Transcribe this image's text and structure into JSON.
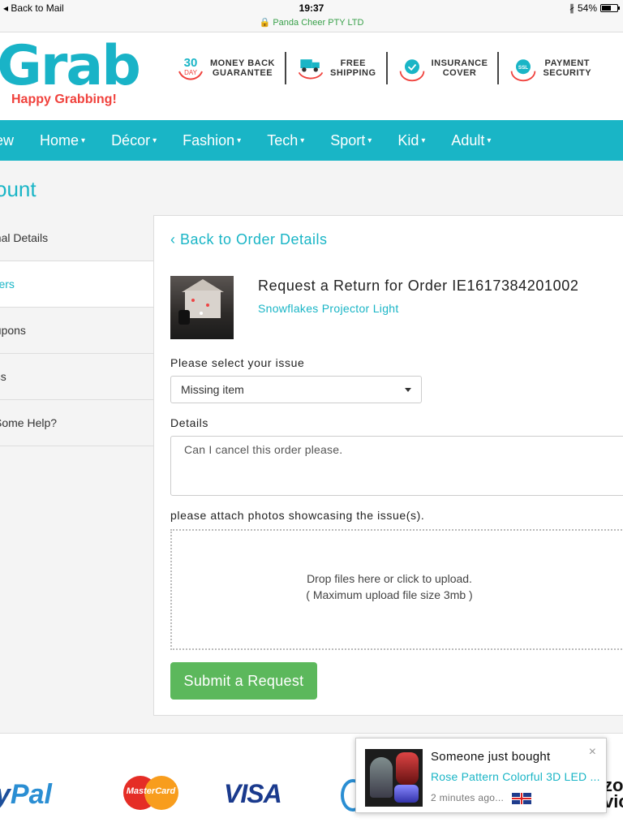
{
  "status_bar": {
    "back": "Back to Mail",
    "time": "19:37",
    "site": "Panda Cheer PTY LTD",
    "battery": "54%",
    "battery_level": 0.54
  },
  "header": {
    "logo": "Grab",
    "tagline": "Happy Grabbing!",
    "badges": [
      {
        "icon": "30-day-icon",
        "line1": "MONEY BACK",
        "line2": "GUARANTEE",
        "num": "30",
        "sub": "DAY"
      },
      {
        "icon": "truck-icon",
        "line1": "FREE",
        "line2": "SHIPPING"
      },
      {
        "icon": "shield-icon",
        "line1": "INSURANCE",
        "line2": "COVER"
      },
      {
        "icon": "ssl-icon",
        "line1": "PAYMENT",
        "line2": "SECURITY",
        "sub": "SSL"
      }
    ]
  },
  "nav": {
    "items": [
      "ew",
      "Home",
      "Décor",
      "Fashion",
      "Tech",
      "Sport",
      "Kid",
      "Adult"
    ]
  },
  "page_title": "ount",
  "sidebar": {
    "items": [
      "onal Details",
      "rders",
      "oupons",
      "ess",
      "l Some Help?"
    ],
    "active_index": 1
  },
  "main": {
    "back_link": "‹ Back to Order Details",
    "request_title": "Request a Return for Order IE1617384201002",
    "product_name": "Snowflakes Projector Light",
    "issue_label": "Please select your issue",
    "issue_value": "Missing item",
    "details_label": "Details",
    "details_value": "Can I cancel this order please.",
    "attach_label": "please attach photos showcasing the issue(s).",
    "drop_line1": "Drop files here or click to upload.",
    "drop_line2": "( Maximum upload file size 3mb )",
    "submit_label": "Submit a Request"
  },
  "footer": {
    "payments": [
      "yPal",
      "MasterCard",
      "VISA",
      "zip-logo"
    ],
    "paypal_a": "y",
    "paypal_b": "Pal",
    "mastercard": "MasterCard",
    "visa": "VISA",
    "zip": "zo\nvic"
  },
  "toast": {
    "title": "Someone just bought",
    "product": "Rose Pattern Colorful 3D LED ...",
    "time": "2 minutes ago...",
    "close": "×"
  },
  "colors": {
    "brand": "#19b5c6",
    "accent_red": "#f0413c",
    "submit_green": "#5cb85c"
  }
}
